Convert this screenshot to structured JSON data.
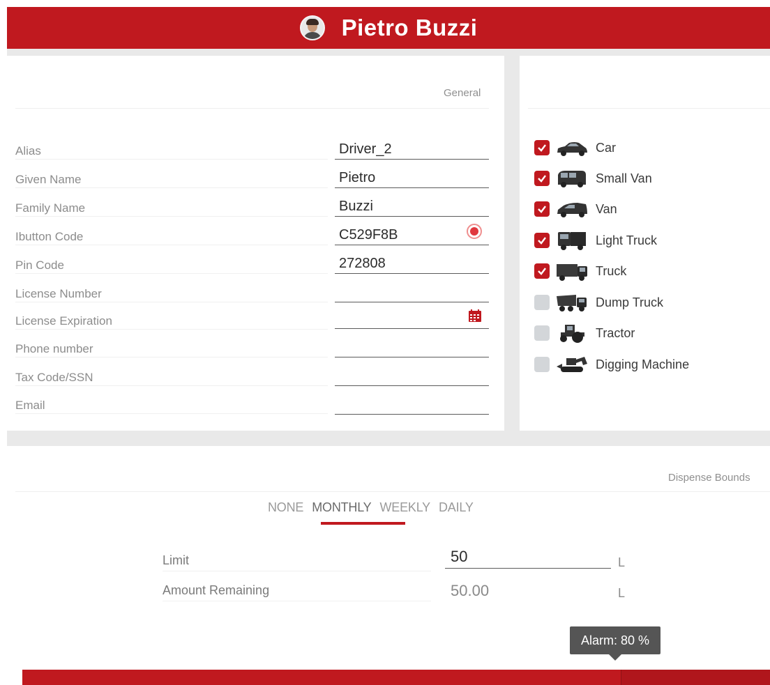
{
  "header": {
    "name": "Pietro Buzzi"
  },
  "general": {
    "section_title": "General",
    "fields": [
      {
        "label": "Alias",
        "value": "Driver_2"
      },
      {
        "label": "Given Name",
        "value": "Pietro"
      },
      {
        "label": "Family Name",
        "value": "Buzzi"
      },
      {
        "label": "Ibutton Code",
        "value": "C529F8B"
      },
      {
        "label": "Pin Code",
        "value": "272808"
      },
      {
        "label": "License Number",
        "value": ""
      },
      {
        "label": "License Expiration",
        "value": ""
      },
      {
        "label": "Phone number",
        "value": ""
      },
      {
        "label": "Tax Code/SSN",
        "value": ""
      },
      {
        "label": "Email",
        "value": ""
      }
    ]
  },
  "vehicles": [
    {
      "label": "Car",
      "checked": true,
      "icon": "car-icon"
    },
    {
      "label": "Small Van",
      "checked": true,
      "icon": "small-van-icon"
    },
    {
      "label": "Van",
      "checked": true,
      "icon": "van-icon"
    },
    {
      "label": "Light Truck",
      "checked": true,
      "icon": "light-truck-icon"
    },
    {
      "label": "Truck",
      "checked": true,
      "icon": "truck-icon"
    },
    {
      "label": "Dump Truck",
      "checked": false,
      "icon": "dump-truck-icon"
    },
    {
      "label": "Tractor",
      "checked": false,
      "icon": "tractor-icon"
    },
    {
      "label": "Digging Machine",
      "checked": false,
      "icon": "digging-machine-icon"
    }
  ],
  "dispense": {
    "section_title": "Dispense Bounds",
    "tabs": [
      "NONE",
      "MONTHLY",
      "WEEKLY",
      "DAILY"
    ],
    "active_tab": "MONTHLY",
    "limit_label": "Limit",
    "limit_value": "50",
    "limit_unit": "L",
    "remaining_label": "Amount Remaining",
    "remaining_value": "50.00",
    "remaining_unit": "L",
    "alarm_text": "Alarm: 80 %",
    "alarm_fraction": 0.8
  },
  "colors": {
    "brand": "#c0191f",
    "checkbox_off": "#d3d6d9",
    "tooltip": "#555555"
  }
}
